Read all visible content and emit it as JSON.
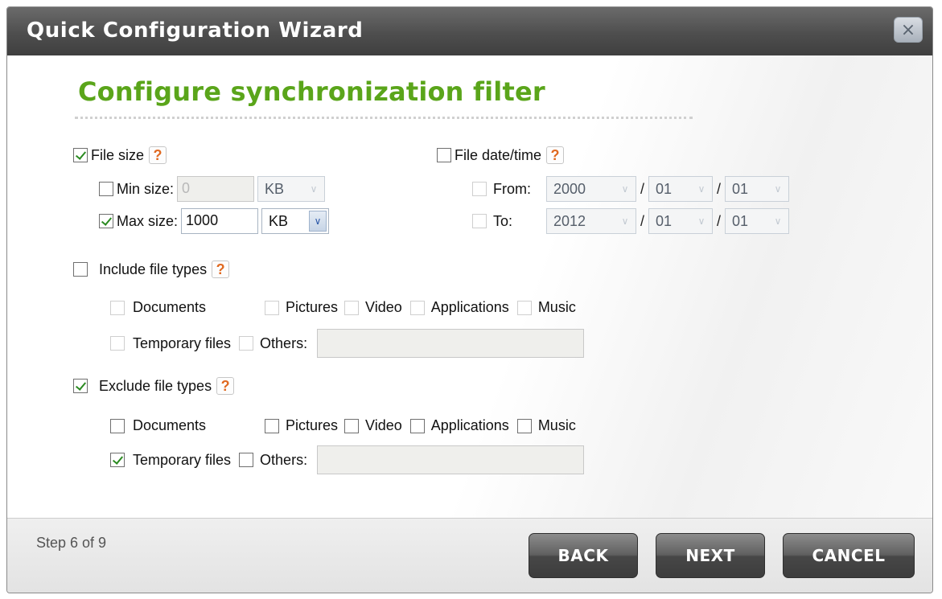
{
  "window": {
    "title": "Quick Configuration Wizard",
    "close_label": "×"
  },
  "page": {
    "heading": "Configure synchronization filter"
  },
  "file_size": {
    "label": "File size",
    "checked": true,
    "min": {
      "label": "Min size:",
      "checked": false,
      "value": "0",
      "unit": "KB"
    },
    "max": {
      "label": "Max size:",
      "checked": true,
      "value": "1000",
      "unit": "KB"
    }
  },
  "file_datetime": {
    "label": "File date/time",
    "checked": false,
    "from": {
      "label": "From:",
      "checked": false,
      "year": "2000",
      "month": "01",
      "day": "01"
    },
    "to": {
      "label": "To:",
      "checked": false,
      "year": "2012",
      "month": "01",
      "day": "01"
    },
    "separator": "/"
  },
  "include_types": {
    "label": "Include file types",
    "checked": false,
    "documents": "Documents",
    "pictures": "Pictures",
    "video": "Video",
    "applications": "Applications",
    "music": "Music",
    "temporary": "Temporary files",
    "others": "Others:",
    "others_value": ""
  },
  "exclude_types": {
    "label": "Exclude file types",
    "checked": true,
    "documents": "Documents",
    "pictures": "Pictures",
    "video": "Video",
    "applications": "Applications",
    "music": "Music",
    "temporary": "Temporary files",
    "temporary_checked": true,
    "others": "Others:",
    "others_value": ""
  },
  "footer": {
    "step": "Step 6 of 9",
    "back": "BACK",
    "next": "NEXT",
    "cancel": "CANCEL"
  },
  "icons": {
    "help": "?",
    "dropdown": "∨"
  },
  "colors": {
    "heading": "#5aa51a",
    "help": "#e06a22",
    "titlebar": "#4e4e4e"
  }
}
